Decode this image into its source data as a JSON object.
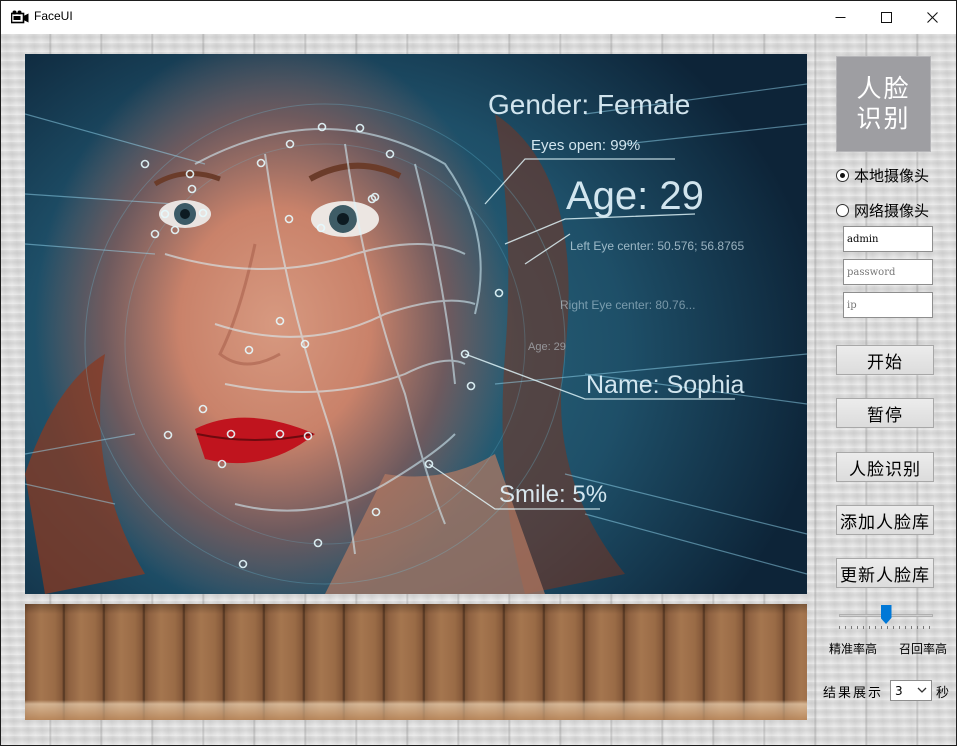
{
  "window": {
    "title": "FaceUI",
    "icon": "camera-icon",
    "controls": [
      "minimize-icon",
      "maximize-icon",
      "close-icon"
    ]
  },
  "video": {
    "overlays": {
      "gender": "Gender: Female",
      "eyes": "Eyes open: 99%",
      "age": "Age: 29",
      "left_eye": "Left Eye center: 50.576; 56.8765",
      "right_eye": "Right Eye center: 80.76...",
      "age_small": "Age: 29",
      "name": "Name: Sophia",
      "smile": "Smile: 5%"
    }
  },
  "panel": {
    "face_tile": {
      "line1": "人脸",
      "line2": "识别"
    },
    "source_options": [
      {
        "label": "本地摄像头",
        "selected": true
      },
      {
        "label": "网络摄像头",
        "selected": false
      }
    ],
    "username": {
      "value": "admin",
      "placeholder": ""
    },
    "password": {
      "value": "",
      "placeholder": "password"
    },
    "ip": {
      "value": "",
      "placeholder": "ip"
    },
    "buttons": {
      "start": "开始",
      "pause": "暂停",
      "recognize": "人脸识别",
      "add_library": "添加人脸库",
      "update_library": "更新人脸库"
    },
    "slider": {
      "left_label": "精准率高",
      "right_label": "召回率高",
      "value": 0.5
    },
    "result": {
      "label": "结果展示",
      "selected": "3",
      "unit": "秒"
    }
  }
}
